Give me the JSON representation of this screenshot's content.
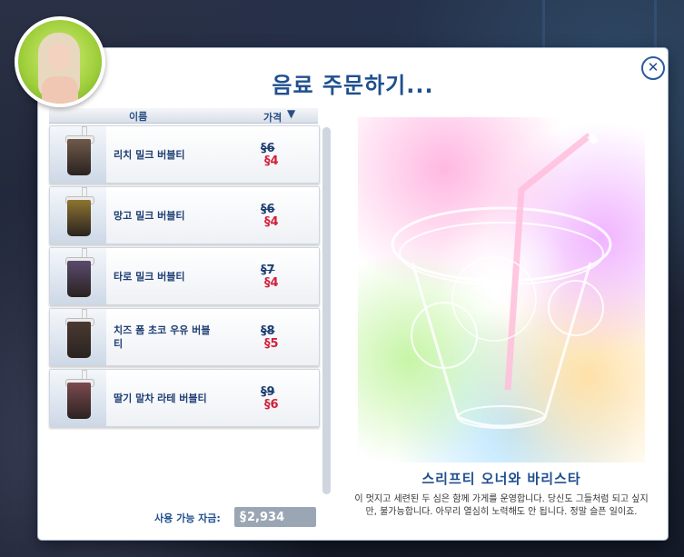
{
  "dialog": {
    "title": "음료 주문하기...",
    "close_glyph": "✕",
    "avatar_icon": "sim-avatar-icon"
  },
  "list": {
    "col_name": "이름",
    "col_price": "가격",
    "sort_glyph": "▼",
    "items": [
      {
        "name": "리치 밀크 버블티",
        "old_price": "§6",
        "new_price": "§4",
        "drink_color": "#6f5a4a"
      },
      {
        "name": "망고 밀크 버블티",
        "old_price": "§6",
        "new_price": "§4",
        "drink_color": "#8d7430"
      },
      {
        "name": "타로 밀크 버블티",
        "old_price": "§7",
        "new_price": "§4",
        "drink_color": "#5a4a6e"
      },
      {
        "name": "치즈 폼 초코 우유 버블티",
        "old_price": "§8",
        "new_price": "§5",
        "drink_color": "#4a3a30"
      },
      {
        "name": "딸기 말차 라테 버블티",
        "old_price": "§9",
        "new_price": "§6",
        "drink_color": "#7c4a4e"
      }
    ]
  },
  "funds": {
    "label": "사용 가능 자금:",
    "currency_glyph": "§",
    "amount": "2,934"
  },
  "detail": {
    "title": "스리프티 오너와 바리스타",
    "description": "이 멋지고 세련된 두 심은 함께 가게를 운영합니다. 당신도 그들처럼 되고 싶지만, 불가능합니다. 아무리 열심히 노력해도 안 됩니다. 정말 슬픈 일이죠."
  }
}
